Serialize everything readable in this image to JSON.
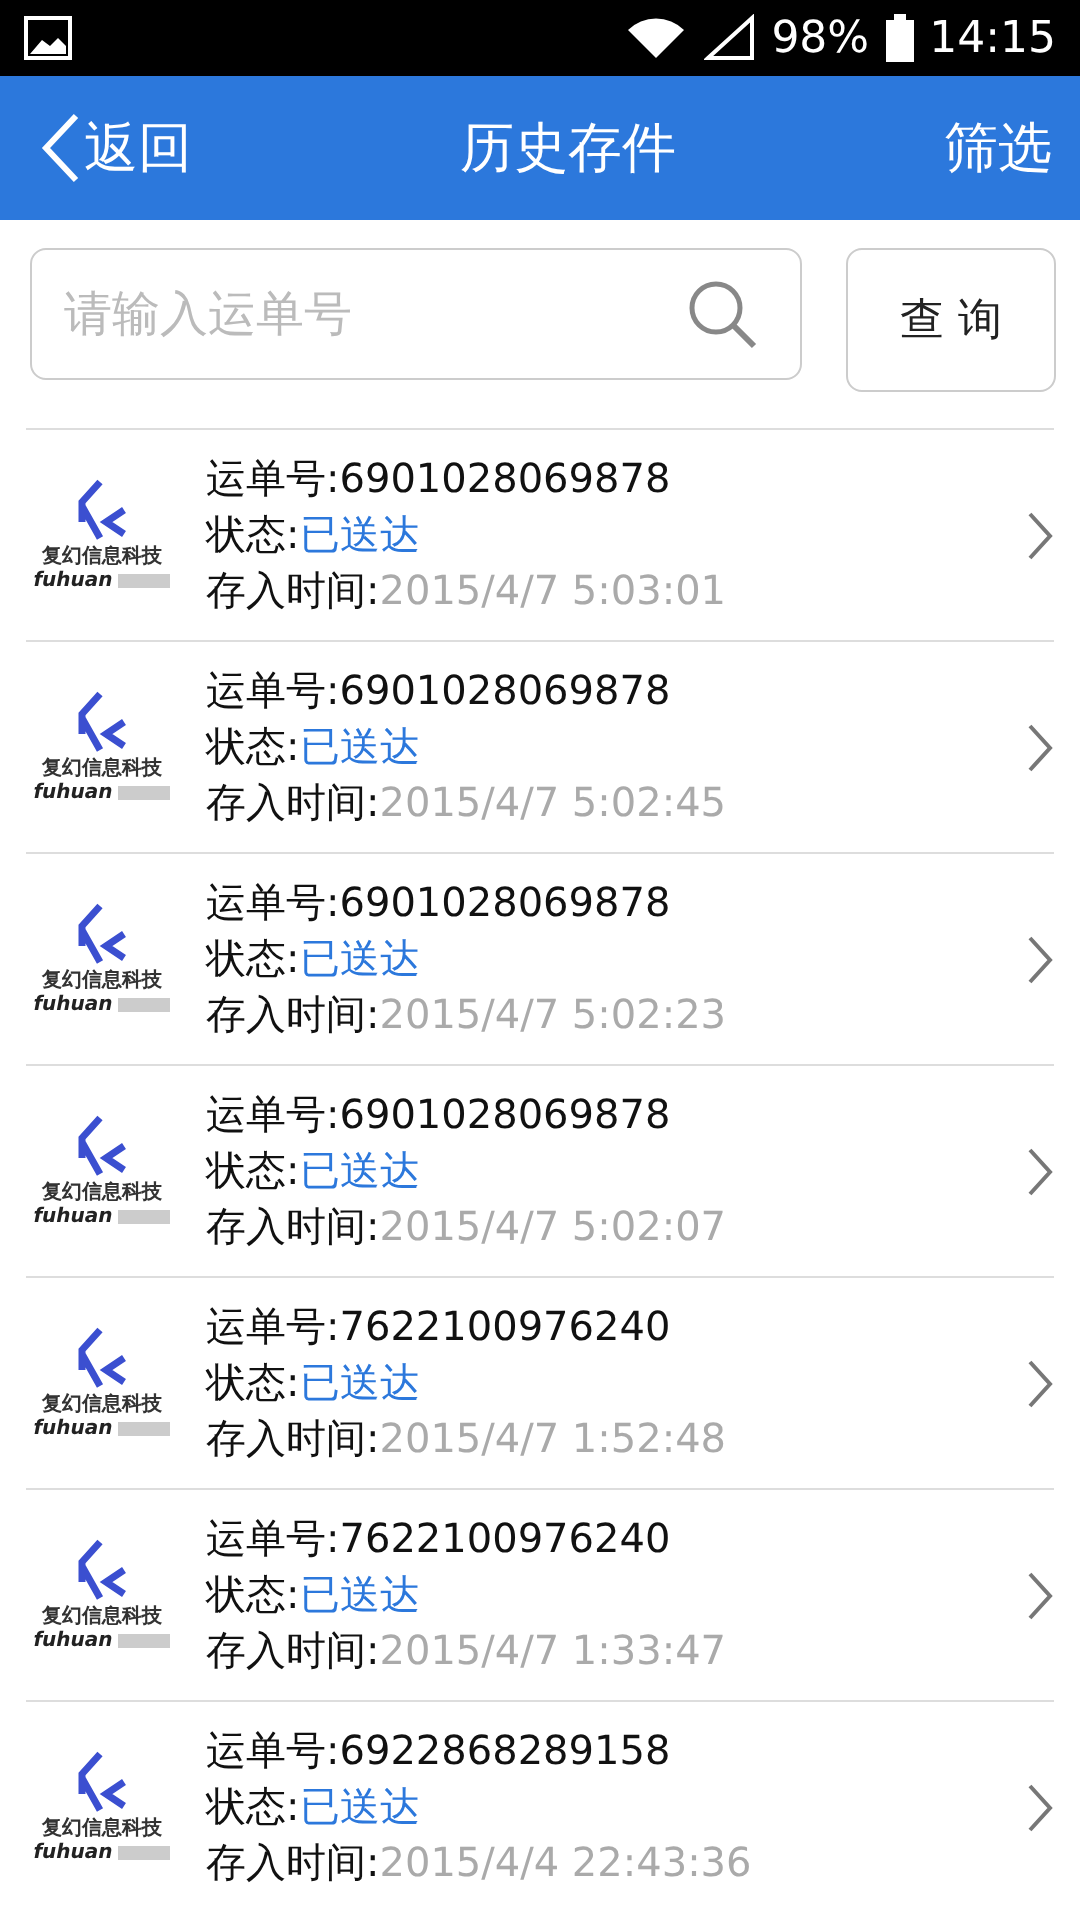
{
  "status_bar": {
    "battery": "98%",
    "time": "14:15"
  },
  "nav": {
    "back": "返回",
    "title": "历史存件",
    "action": "筛选"
  },
  "search": {
    "placeholder": "请输入运单号",
    "button": "查 询"
  },
  "rows": [
    {
      "logo_name": "复幻信息科技",
      "logo_latin": "fuhuan",
      "waybill_label": "运单号:",
      "waybill": "6901028069878",
      "status_label": "状态:",
      "status": "已送达",
      "time_label": "存入时间:",
      "time": "2015/4/7 5:03:01"
    },
    {
      "logo_name": "复幻信息科技",
      "logo_latin": "fuhuan",
      "waybill_label": "运单号:",
      "waybill": "6901028069878",
      "status_label": "状态:",
      "status": "已送达",
      "time_label": "存入时间:",
      "time": "2015/4/7 5:02:45"
    },
    {
      "logo_name": "复幻信息科技",
      "logo_latin": "fuhuan",
      "waybill_label": "运单号:",
      "waybill": "6901028069878",
      "status_label": "状态:",
      "status": "已送达",
      "time_label": "存入时间:",
      "time": "2015/4/7 5:02:23"
    },
    {
      "logo_name": "复幻信息科技",
      "logo_latin": "fuhuan",
      "waybill_label": "运单号:",
      "waybill": "6901028069878",
      "status_label": "状态:",
      "status": "已送达",
      "time_label": "存入时间:",
      "time": "2015/4/7 5:02:07"
    },
    {
      "logo_name": "复幻信息科技",
      "logo_latin": "fuhuan",
      "waybill_label": "运单号:",
      "waybill": "7622100976240",
      "status_label": "状态:",
      "status": "已送达",
      "time_label": "存入时间:",
      "time": "2015/4/7 1:52:48"
    },
    {
      "logo_name": "复幻信息科技",
      "logo_latin": "fuhuan",
      "waybill_label": "运单号:",
      "waybill": "7622100976240",
      "status_label": "状态:",
      "status": "已送达",
      "time_label": "存入时间:",
      "time": "2015/4/7 1:33:47"
    },
    {
      "logo_name": "复幻信息科技",
      "logo_latin": "fuhuan",
      "waybill_label": "运单号:",
      "waybill": "6922868289158",
      "status_label": "状态:",
      "status": "已送达",
      "time_label": "存入时间:",
      "time": "2015/4/4 22:43:36"
    }
  ]
}
